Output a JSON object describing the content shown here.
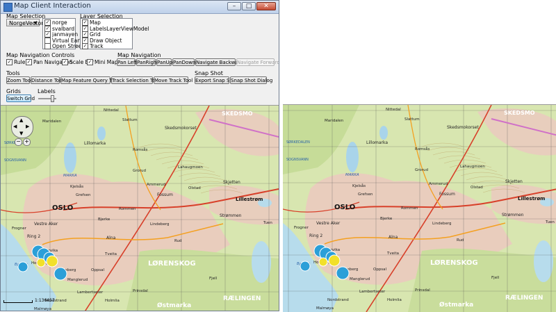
{
  "window": {
    "title": "Map Client Interaction",
    "minimize": "–",
    "maximize": "□",
    "close": "✕"
  },
  "map_selection": {
    "label": "Map Selection",
    "selected": "NorgeVector"
  },
  "map_sources": [
    {
      "name": "norge",
      "checked": true
    },
    {
      "name": "svalbard",
      "checked": true
    },
    {
      "name": "janmayen",
      "checked": true
    },
    {
      "name": "Virtual Earth",
      "checked": false
    },
    {
      "name": "Open Street",
      "checked": false
    }
  ],
  "layer_selection": {
    "label": "Layer Selection"
  },
  "layers": [
    {
      "name": "Map",
      "checked": true
    },
    {
      "name": "LabelsLayerViewModel",
      "checked": true
    },
    {
      "name": "Grid",
      "checked": true
    },
    {
      "name": "Draw Object",
      "checked": true
    },
    {
      "name": "Track",
      "checked": true
    }
  ],
  "nav_controls": {
    "label": "Map Navigation Controls",
    "ruler": "Ruler",
    "pan": "Pan Navigation",
    "scalebar": "Scale Bar",
    "minimap": "Mini Map"
  },
  "map_navigation": {
    "label": "Map Navigation",
    "pan_left": "Pan Left",
    "pan_right": "PanRight",
    "pan_up": "PanUp",
    "pan_down": "PanDown",
    "back": "Navigate Backward",
    "forward": "Navigate Forward"
  },
  "tools": {
    "label": "Tools",
    "zoom": "Zoom Tool",
    "distance": "Distance Tool",
    "feature_query": "Map Feature Query Tool",
    "track_selection": "Track Selection Tool",
    "move_track": "Move Track Tool"
  },
  "snapshot": {
    "label": "Snap Shot",
    "export": "Export Snap Shot",
    "dialog": "Snap Shot Dialog"
  },
  "grids": {
    "label": "Grids",
    "switch": "Switch Grid"
  },
  "labels": {
    "label": "Labels"
  },
  "scale_text": "1:136457",
  "map_labels": {
    "oslo": "OSLO",
    "lillestrom": "Lillestrøm",
    "lorenskog": "LØRENSKOG",
    "raelingen": "RÆLINGEN",
    "skedsmo": "SKEDSMO",
    "skedsmokorset": "Skedsmokorset",
    "vestre_aker": "Vestre Aker",
    "ring2": "Ring 2",
    "frogner": "Frogner",
    "alna": "Alna",
    "bygdoy": "Bygdøy",
    "ostmarka": "Østmarka",
    "maridalen": "Maridalen",
    "lillomarka": "Lillomarka",
    "sorkedalen": "SØRKEDALEN",
    "strommen": "Strømmen",
    "skjetten": "Skjetten",
    "fossum": "Fossum",
    "slattum": "Slattum",
    "grefsen": "Grefsen",
    "hovedoya": "Hovedøya",
    "malmoya": "Malmøya",
    "romsas": "Romsås",
    "tuen": "Tuen",
    "lahaugmoen": "Lahaugmoen",
    "ammerud": "Ammerud",
    "olstad": "Olstad",
    "marka": "MARKA",
    "lamberseter": "Lambertseter",
    "fjell": "Fjell",
    "nittedal": "Nittedal",
    "kjelsas": "Kjelsås",
    "grorud": "Grorud",
    "rommen": "Rommen",
    "lindeberg": "Lindeberg",
    "oppsal": "Oppsal",
    "tveita": "Tveita",
    "manglerud": "Manglerud",
    "sognsvann": "SOGNSVANN",
    "nordstrand": "Nordstrand",
    "holmlia": "Holmlia",
    "prinsdal": "Prinsdal",
    "rud": "Rud",
    "ekeberg": "Ekeberg",
    "bjerke": "Bjerke",
    "bjorvik": "Bjørvika"
  }
}
